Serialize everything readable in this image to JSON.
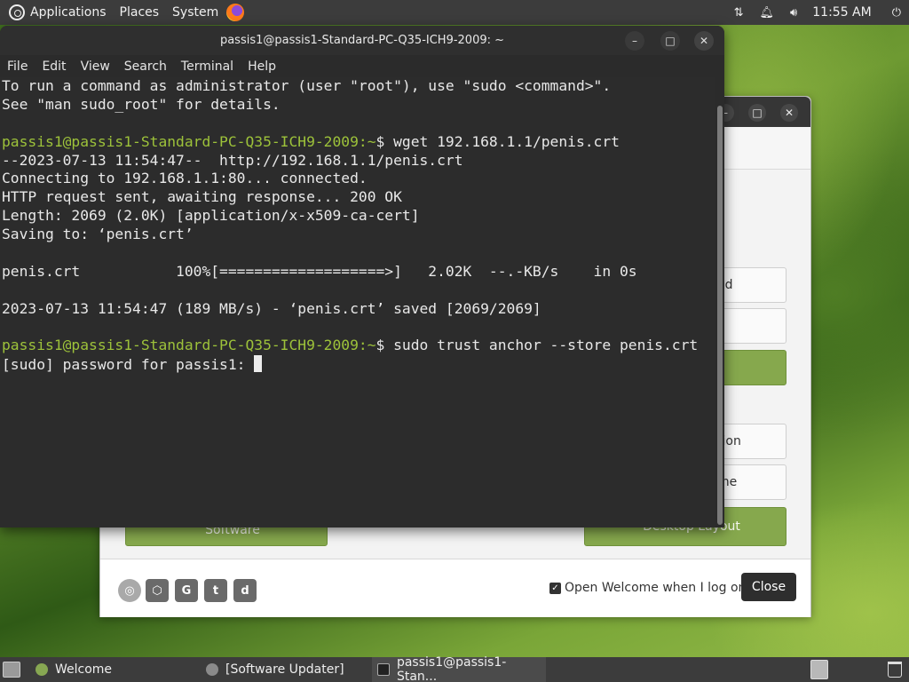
{
  "top_panel": {
    "menus": [
      "Applications",
      "Places",
      "System"
    ],
    "time": "11:55 AM",
    "icons": [
      "ubuntu-mate-icon",
      "firefox-icon",
      "network-icon",
      "notification-bell-icon",
      "volume-icon",
      "power-icon"
    ]
  },
  "welcome_window": {
    "buttons": {
      "partial_1": "ed",
      "partial_2": "tion",
      "partial_3": "me",
      "software": "Software",
      "desktop_layout": "Desktop Layout"
    },
    "footer": {
      "checkbox_label": "Open Welcome when I log on.",
      "checkbox_checked": true,
      "close_label": "Close",
      "social_icons": [
        "ubuntu-mate-icon",
        "software-boutique-icon",
        "github-icon",
        "twitter-icon",
        "discord-icon"
      ]
    }
  },
  "terminal": {
    "title": "passis1@passis1-Standard-PC-Q35-ICH9-2009: ~",
    "menu": [
      "File",
      "Edit",
      "View",
      "Search",
      "Terminal",
      "Help"
    ],
    "prompt_user": "passis1@passis1-Standard-PC-Q35-ICH9-2009",
    "prompt_path": ":~",
    "lines": {
      "l1": "To run a command as administrator (user \"root\"), use \"sudo <command>\".",
      "l2": "See \"man sudo_root\" for details.",
      "cmd1": "$ wget 192.168.1.1/penis.crt",
      "l4": "--2023-07-13 11:54:47--  http://192.168.1.1/penis.crt",
      "l5": "Connecting to 192.168.1.1:80... connected.",
      "l6": "HTTP request sent, awaiting response... 200 OK",
      "l7": "Length: 2069 (2.0K) [application/x-x509-ca-cert]",
      "l8": "Saving to: ‘penis.crt’",
      "l10": "penis.crt           100%[===================>]   2.02K  --.-KB/s    in 0s",
      "l12": "2023-07-13 11:54:47 (189 MB/s) - ‘penis.crt’ saved [2069/2069]",
      "cmd2": "$ sudo trust anchor --store penis.crt",
      "l15": "[sudo] password for passis1: "
    }
  },
  "taskbar": {
    "tasks": [
      "Welcome",
      "[Software Updater]",
      "passis1@passis1-Stan..."
    ]
  }
}
